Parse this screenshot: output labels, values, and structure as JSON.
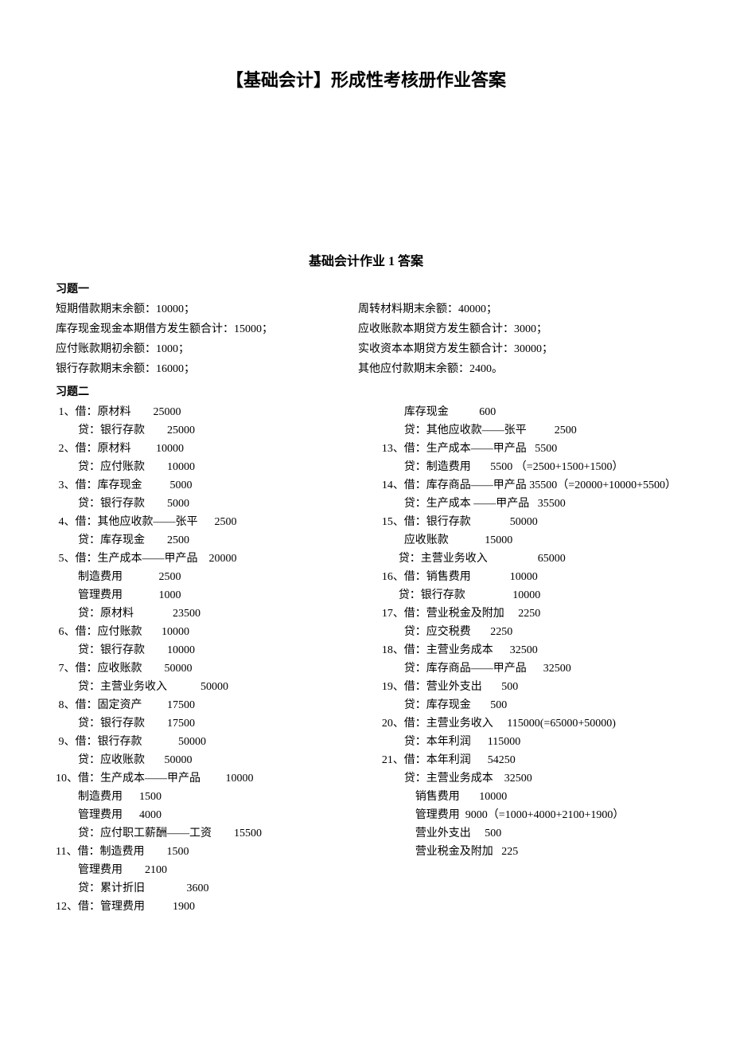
{
  "title": "【基础会计】形成性考核册作业答案",
  "subtitle": "基础会计作业 1 答案",
  "section1_label": "习题一",
  "section2_label": "习题二",
  "q1_left": [
    "短期借款期末余额：10000；",
    "库存现金现金本期借方发生额合计：15000；",
    "应付账款期初余额：1000；",
    "银行存款期末余额：16000；"
  ],
  "q1_right": [
    "周转材料期末余额：40000；",
    "应收账款本期贷方发生额合计：3000；",
    "实收资本本期贷方发生额合计：30000；",
    "其他应付款期末余额：2400。"
  ],
  "q2_left": [
    " 1、借：原材料        25000",
    "        贷：银行存款        25000",
    " 2、借：原材料         10000",
    "        贷：应付账款        10000",
    " 3、借：库存现金          5000",
    "        贷：银行存款        5000",
    " 4、借：其他应收款——张平      2500",
    "        贷：库存现金        2500",
    " 5、借：生产成本——甲产品    20000",
    "        制造费用             2500",
    "        管理费用             1000",
    "        贷：原材料              23500",
    " 6、借：应付账款       10000",
    "        贷：银行存款        10000",
    " 7、借：应收账款        50000",
    "        贷：主营业务收入            50000",
    " 8、借：固定资产         17500",
    "        贷：银行存款        17500",
    " 9、借：银行存款             50000",
    "        贷：应收账款       50000",
    "10、借：生产成本——甲产品         10000",
    "        制造费用      1500",
    "        管理费用      4000",
    "        贷：应付职工薪酬——工资        15500",
    "11、借：制造费用        1500",
    "        管理费用        2100",
    "        贷：累计折旧               3600",
    "12、借：管理费用          1900"
  ],
  "q2_right": [
    "        库存现金           600",
    "        贷：其他应收款——张平          2500",
    "13、借：生产成本——甲产品   5500",
    "        贷：制造费用       5500 （=2500+1500+1500）",
    "14、借：库存商品——甲产品 35500（=20000+10000+5500）",
    "        贷：生产成本 ——甲产品   35500",
    "15、借：银行存款              50000",
    "        应收账款             15000",
    "      贷：主营业务收入                  65000",
    "16、借：销售费用              10000",
    "      贷：银行存款                 10000",
    "17、借：营业税金及附加     2250",
    "        贷：应交税费       2250",
    "18、借：主营业务成本      32500",
    "        贷：库存商品——甲产品      32500",
    "19、借：营业外支出       500",
    "        贷：库存现金       500",
    "20、借：主营业务收入     115000(=65000+50000)",
    "        贷：本年利润      115000",
    "21、借：本年利润      54250",
    "        贷：主营业务成本    32500",
    "            销售费用       10000",
    "            管理费用  9000（=1000+4000+2100+1900）",
    "            营业外支出     500",
    "            营业税金及附加   225"
  ]
}
